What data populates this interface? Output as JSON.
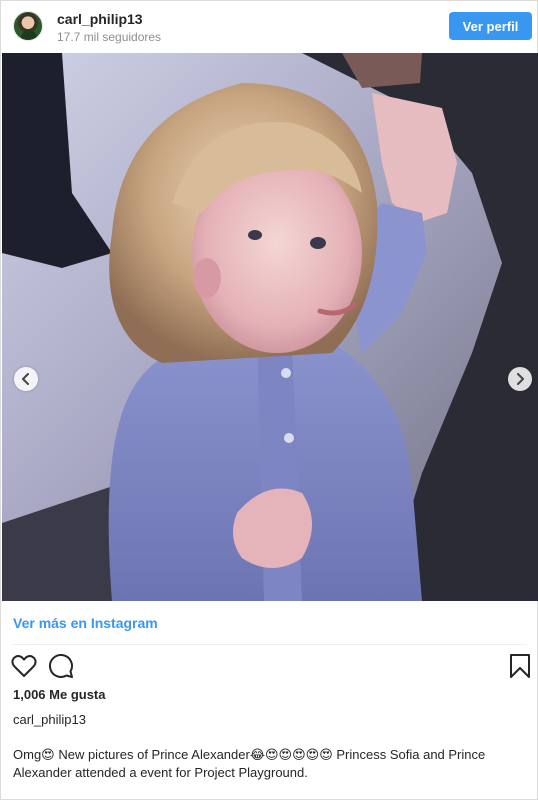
{
  "header": {
    "username": "carl_philip13",
    "followers": "17.7 mil seguidores",
    "follow_button": "Ver perfil"
  },
  "photo": {
    "alt": "Toddler with curly hair in a blue shirt holding an adult's hand",
    "prev_icon": "chevron-left-icon",
    "next_icon": "chevron-right-icon"
  },
  "link": {
    "more_label": "Ver más en Instagram"
  },
  "actions": {
    "like_icon": "heart-icon",
    "comment_icon": "comment-icon",
    "save_icon": "bookmark-icon"
  },
  "post": {
    "likes": "1,006 Me gusta",
    "author": "carl_philip13",
    "caption": "Omg😍 New pictures of Prince Alexander😂😍😍😍😍😍 Princess Sofia and Prince Alexander attended a event for Project Playground."
  },
  "colors": {
    "accent": "#3897f0",
    "text": "#262626",
    "muted": "#8e8e8e",
    "border": "#dbdbdb"
  }
}
